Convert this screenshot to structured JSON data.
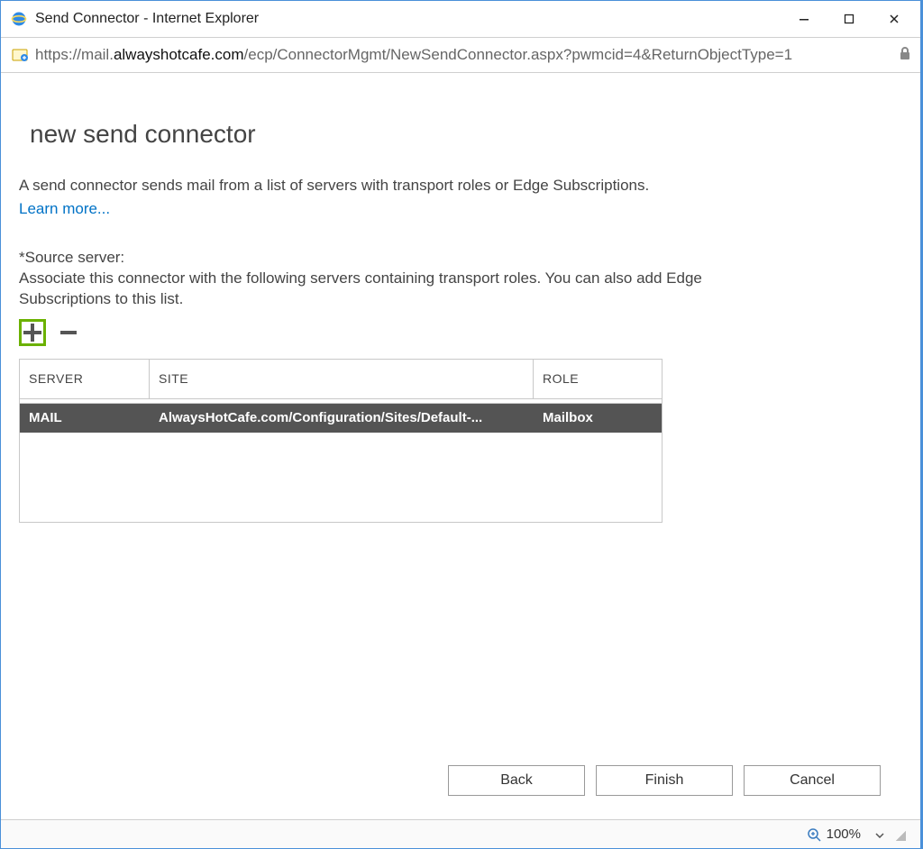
{
  "window": {
    "title": "Send Connector - Internet Explorer"
  },
  "address": {
    "scheme": "https://",
    "host_prefix": "mail.",
    "host": "alwayshotcafe.com",
    "path": "/ecp/ConnectorMgmt/NewSendConnector.aspx?pwmcid=4&ReturnObjectType=1"
  },
  "page": {
    "title": "new send connector",
    "intro": "A send connector sends mail from a list of servers with transport roles or Edge Subscriptions.",
    "learn_more": "Learn more...",
    "source_label": "*Source server:",
    "source_desc": "Associate this connector with the following servers containing transport roles. You can also add Edge Subscriptions to this list."
  },
  "table": {
    "headers": {
      "server": "SERVER",
      "site": "SITE",
      "role": "ROLE"
    },
    "rows": [
      {
        "server": "MAIL",
        "site": "AlwaysHotCafe.com/Configuration/Sites/Default-...",
        "role": "Mailbox",
        "selected": true
      }
    ]
  },
  "buttons": {
    "back": "Back",
    "finish": "Finish",
    "cancel": "Cancel"
  },
  "status": {
    "zoom": "100%"
  }
}
